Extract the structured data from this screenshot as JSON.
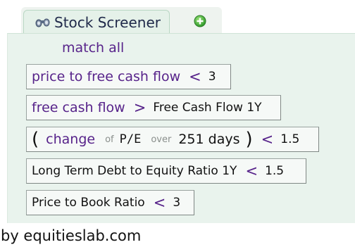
{
  "header": {
    "tab_title": "Stock Screener",
    "tab_icon": "binoculars-icon",
    "add_icon": "plus-circle-icon",
    "accent_green": "#3aa832"
  },
  "match_mode": "match all",
  "criteria": [
    {
      "metric": "price to free cash flow",
      "operator": "<",
      "value": "3"
    },
    {
      "metric": "free cash flow",
      "operator": ">",
      "value": "Free Cash Flow 1Y"
    },
    {
      "open_paren": "(",
      "function": "change",
      "of_label": "of",
      "metric": "P/E",
      "over_label": "over",
      "period": "251 days",
      "close_paren": ")",
      "operator": "<",
      "value": "1.5"
    },
    {
      "metric": "Long Term Debt to Equity Ratio 1Y",
      "operator": "<",
      "value": "1.5"
    },
    {
      "metric": "Price to Book Ratio",
      "operator": "<",
      "value": "3"
    }
  ],
  "footer": "by equitieslab.com"
}
